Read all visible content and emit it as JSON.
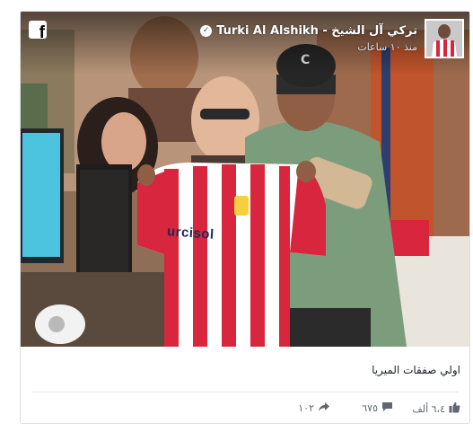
{
  "post": {
    "author_name": "Turki Al Alshikh - تركي آل الشيخ",
    "time": "منذ ١٠ ساعات",
    "caption": "اولي صفقات الميريا",
    "shirt_text": "urcisol",
    "stats": {
      "likes": "٦،٤ ألف",
      "comments": "٦٧٥",
      "shares": "١٠٢"
    }
  },
  "icons": {
    "facebook": "facebook-logo-icon",
    "verified": "verified-check-icon",
    "like": "thumbs-up-icon",
    "comment": "comment-bubble-icon",
    "share": "share-arrow-icon"
  },
  "colors": {
    "card_border": "#dddfe2",
    "text": "#1d2129",
    "stat_text": "#606770",
    "shirt_red": "#d7263d"
  }
}
